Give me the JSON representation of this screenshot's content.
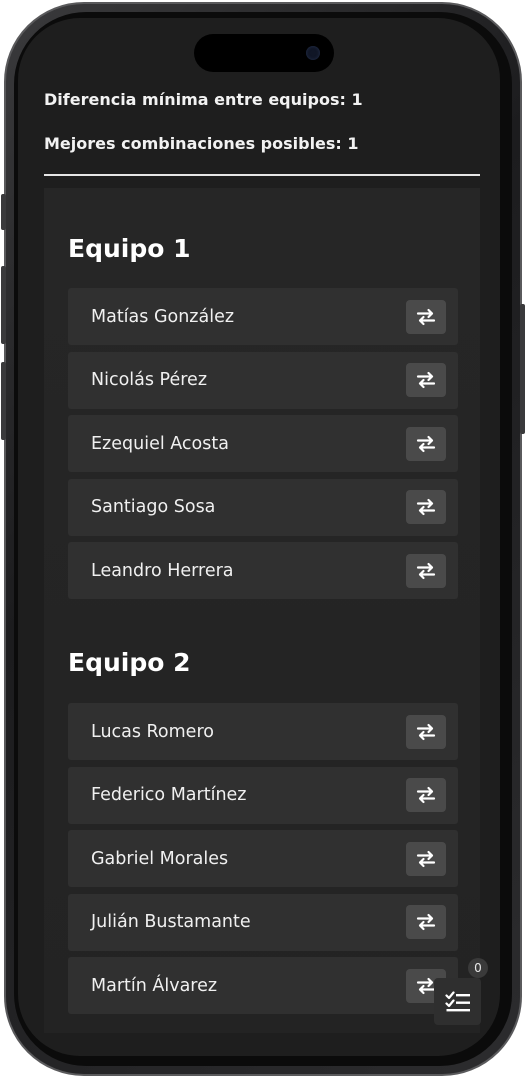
{
  "summary": {
    "min_difference": "Diferencia mínima entre equipos: 1",
    "best_combinations": "Mejores combinaciones posibles: 1"
  },
  "teams": [
    {
      "title": "Equipo 1",
      "players": [
        "Matías González",
        "Nicolás Pérez",
        "Ezequiel Acosta",
        "Santiago Sosa",
        "Leandro Herrera"
      ]
    },
    {
      "title": "Equipo 2",
      "players": [
        "Lucas Romero",
        "Federico Martínez",
        "Gabriel Morales",
        "Julián Bustamante",
        "Martín Álvarez"
      ]
    }
  ],
  "fab": {
    "icon": "checklist-icon",
    "badge": "0"
  },
  "icons": {
    "swap": "swap-arrows-icon"
  },
  "colors": {
    "screen_bg": "#1e1e1e",
    "row_bg": "#303030",
    "button_bg": "#4a4a4a",
    "text": "#f0f0f0"
  }
}
